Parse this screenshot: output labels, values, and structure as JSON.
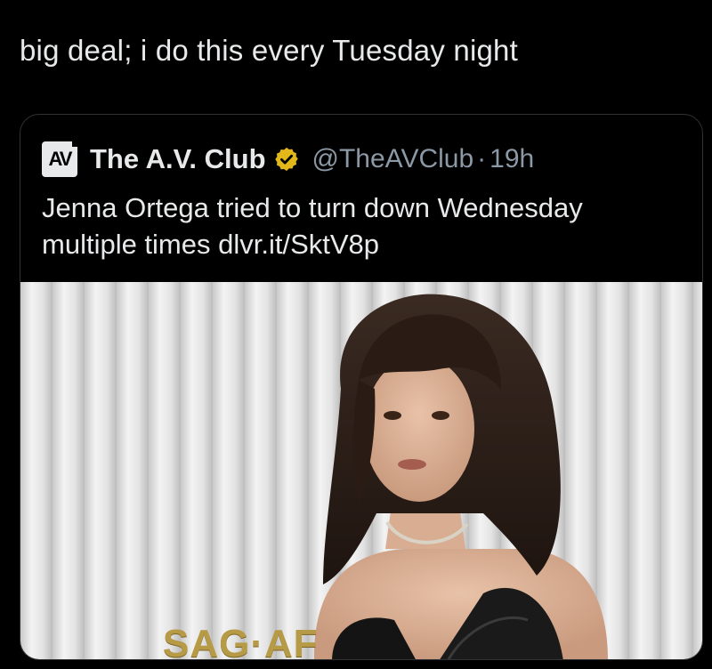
{
  "tweet": {
    "text": "big deal; i do this every Tuesday night"
  },
  "quoted_tweet": {
    "logo_text": "AV",
    "author_name": "The A.V. Club",
    "handle": "@TheAVClub",
    "separator": "·",
    "time": "19h",
    "text": "Jenna Ortega tried to turn down Wednesday multiple times dlvr.it/SktV8p",
    "image": {
      "backdrop_text": "SAG·AF",
      "backdrop_color": "#e8e8e8",
      "sign_color": "#b79a45"
    }
  },
  "colors": {
    "background": "#000000",
    "text": "#e7e9ea",
    "muted": "#8b98a5",
    "border": "#2f3336",
    "verified": "#e2b719"
  }
}
